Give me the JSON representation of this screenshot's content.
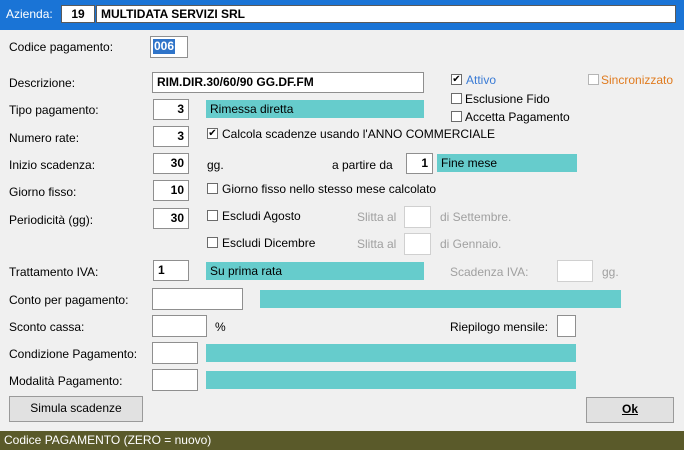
{
  "header": {
    "azienda_label": "Azienda:",
    "azienda_code": "19",
    "azienda_name": "MULTIDATA SERVIZI SRL"
  },
  "form": {
    "codice_label": "Codice pagamento:",
    "codice_value": "006",
    "descrizione_label": "Descrizione:",
    "descrizione_value": "RIM.DIR.30/60/90 GG.DF.FM",
    "attivo_label": "Attivo",
    "attivo_checked": true,
    "sincronizzato_label": "Sincronizzato",
    "esclusione_fido_label": "Esclusione Fido",
    "accetta_pagamento_label": "Accetta Pagamento",
    "tipo_label": "Tipo pagamento:",
    "tipo_value": "3",
    "tipo_desc": "Rimessa diretta",
    "rate_label": "Numero rate:",
    "rate_value": "3",
    "calcola_label": "Calcola scadenze usando l'ANNO COMMERCIALE",
    "calcola_checked": true,
    "inizio_label": "Inizio scadenza:",
    "inizio_value": "30",
    "gg_label": "gg.",
    "apartire_label": "a partire da",
    "apartire_value": "1",
    "apartire_desc": "Fine mese",
    "giorno_label": "Giorno fisso:",
    "giorno_value": "10",
    "giorno_stesso_label": "Giorno fisso nello stesso mese calcolato",
    "periodicita_label": "Periodicità (gg):",
    "periodicita_value": "30",
    "escludi_agosto_label": "Escludi Agosto",
    "slitta_label": "Slitta al",
    "settembre_label": "di Settembre.",
    "escludi_dicembre_label": "Escludi Dicembre",
    "gennaio_label": "di Gennaio.",
    "iva_label": "Trattamento IVA:",
    "iva_value": "1",
    "iva_desc": "Su prima rata",
    "scadenza_iva_label": "Scadenza IVA:",
    "scadenza_iva_gg": "gg.",
    "conto_label": "Conto per pagamento:",
    "sconto_label": "Sconto cassa:",
    "percent_label": "%",
    "riepilogo_label": "Riepilogo mensile:",
    "condizione_label": "Condizione Pagamento:",
    "modalita_label": "Modalità Pagamento:"
  },
  "buttons": {
    "simula": "Simula scadenze",
    "ok": "Ok"
  },
  "status": "Codice PAGAMENTO (ZERO = nuovo)",
  "colors": {
    "accent": "#1a74d6",
    "lookup": "#66cccc",
    "status_bar": "#5a5a2a",
    "attivo": "#3a7bd5",
    "sincronizzato": "#e07b1f"
  }
}
